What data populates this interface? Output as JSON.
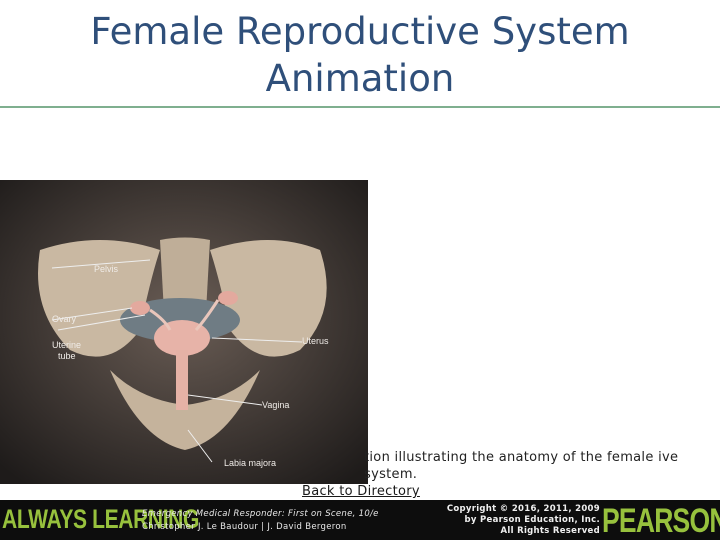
{
  "slide": {
    "title_line1": "Female Reproductive System",
    "title_line2": "Animation",
    "description": "tion illustrating the anatomy of the female ive system.",
    "back_link": "Back to Directory"
  },
  "video": {
    "labels": {
      "pelvis": "Pelvis",
      "ovary": "Ovary",
      "uterus": "Uterus",
      "uterine_tube_1": "Uterine",
      "uterine_tube_2": "tube",
      "vagina": "Vagina",
      "labia_majora": "Labia majora"
    }
  },
  "footer": {
    "brand_left": "ALWAYS LEARNING",
    "book_title": "Emergency Medical Responder: First on Scene, 10/e",
    "authors": "Christopher J. Le Baudour | J. David Bergeron",
    "copyright_line1": "Copyright © 2016, 2011, 2009",
    "copyright_line2": "by Pearson Education, Inc.",
    "copyright_line3": "All Rights Reserved",
    "brand_right": "PEARSON"
  },
  "colors": {
    "title": "#2f4f7a",
    "rule": "#7faf8f",
    "brand_green": "#97c13d",
    "footer_bg": "#0d0d0d"
  }
}
